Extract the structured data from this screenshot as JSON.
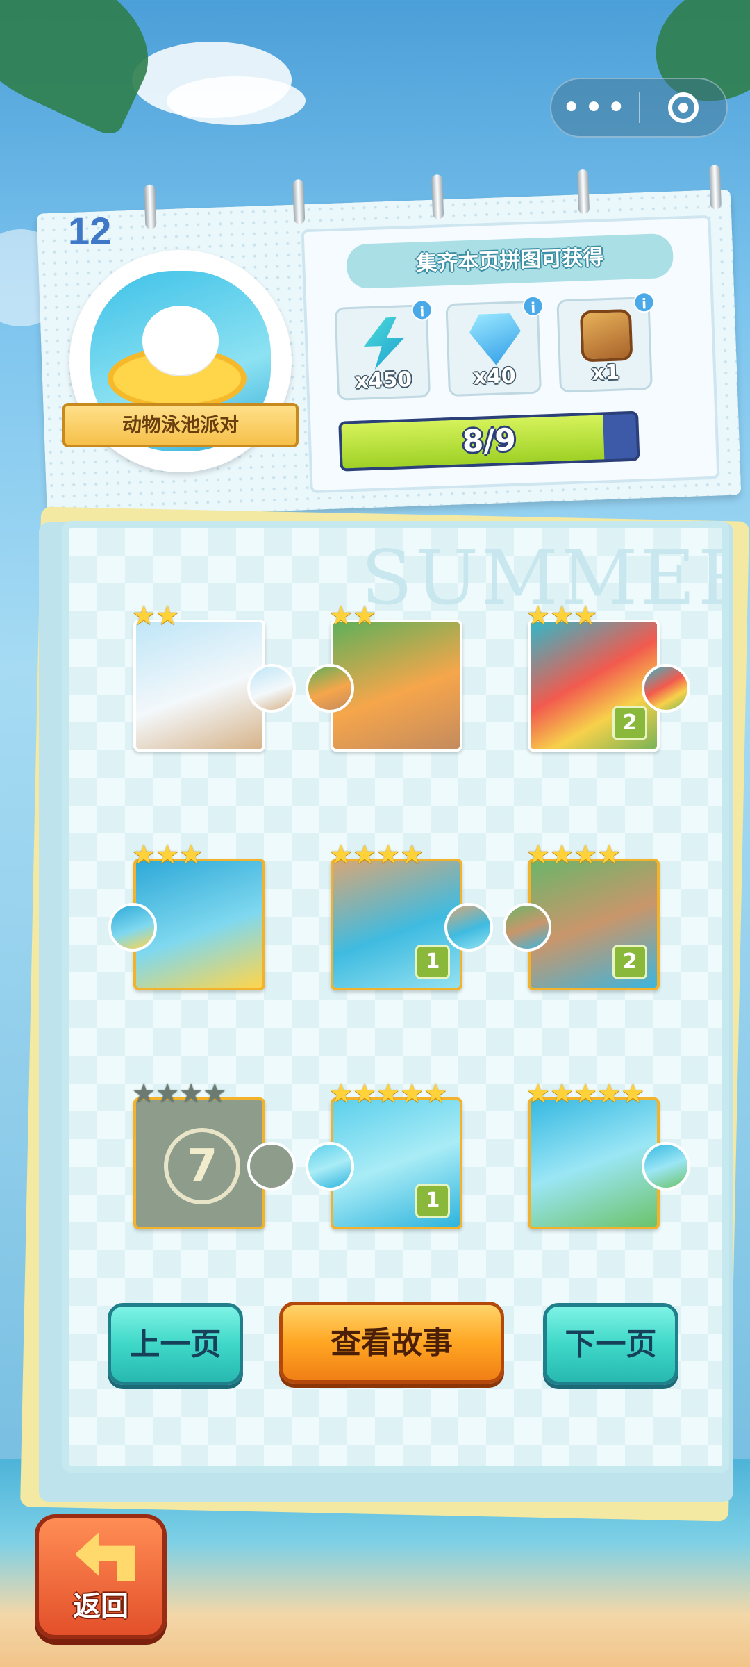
{
  "capsule": {
    "menu_icon": "more-dots-icon",
    "close_icon": "target-icon"
  },
  "album": {
    "page_number": "12",
    "theme_title": "动物泳池派对"
  },
  "rewards_panel": {
    "title": "集齐本页拼图可获得",
    "items": [
      {
        "icon": "energy-bolt-icon",
        "qty": "x450"
      },
      {
        "icon": "diamond-icon",
        "qty": "x40"
      },
      {
        "icon": "treasure-chest-icon",
        "qty": "x1"
      }
    ],
    "progress_text": "8/9",
    "progress_fraction": 0.89
  },
  "watermark": "SUMMER",
  "pieces": [
    {
      "id": 1,
      "stars": 2,
      "max_stars": 2,
      "locked": false,
      "count": "",
      "theme": "balloons"
    },
    {
      "id": 2,
      "stars": 2,
      "max_stars": 2,
      "locked": false,
      "count": "",
      "theme": "cat-sunbathing"
    },
    {
      "id": 3,
      "stars": 3,
      "max_stars": 3,
      "locked": false,
      "count": "2",
      "theme": "umbrella"
    },
    {
      "id": 4,
      "stars": 3,
      "max_stars": 3,
      "locked": false,
      "count": "",
      "theme": "bear-float"
    },
    {
      "id": 5,
      "stars": 4,
      "max_stars": 4,
      "locked": false,
      "count": "1",
      "theme": "pool-deck"
    },
    {
      "id": 6,
      "stars": 4,
      "max_stars": 4,
      "locked": false,
      "count": "2",
      "theme": "bear-lounging"
    },
    {
      "id": 7,
      "stars": 0,
      "max_stars": 4,
      "locked": true,
      "count": "",
      "label": "7"
    },
    {
      "id": 8,
      "stars": 5,
      "max_stars": 5,
      "locked": false,
      "count": "1",
      "theme": "pool-water"
    },
    {
      "id": 9,
      "stars": 5,
      "max_stars": 5,
      "locked": false,
      "count": "",
      "theme": "beach-ball"
    }
  ],
  "buttons": {
    "prev": "上一页",
    "story": "查看故事",
    "next": "下一页",
    "back": "返回"
  }
}
